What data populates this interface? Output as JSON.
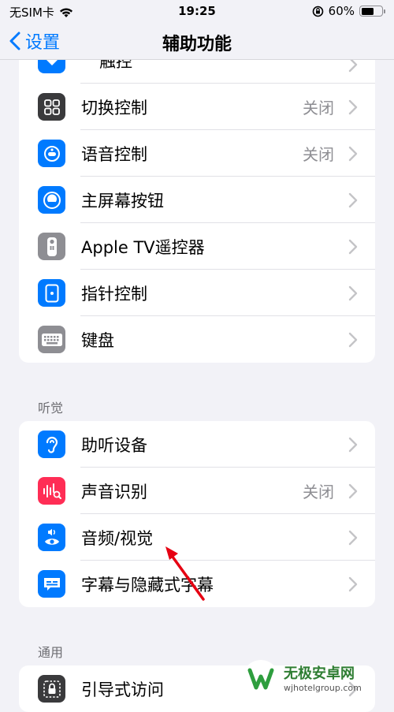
{
  "status_bar": {
    "carrier": "无SIM卡",
    "time": "19:25",
    "battery": "60%",
    "battery_level": 0.6
  },
  "nav": {
    "back_label": "设置",
    "title": "辅助功能"
  },
  "groups": [
    {
      "partial_top_label": "触控",
      "rows": [
        {
          "label": "切换控制",
          "value": "关闭",
          "icon": "switch-control-icon",
          "color": "#3a3a3c"
        },
        {
          "label": "语音控制",
          "value": "关闭",
          "icon": "voice-control-icon",
          "color": "#007aff"
        },
        {
          "label": "主屏幕按钮",
          "value": "",
          "icon": "home-button-icon",
          "color": "#007aff"
        },
        {
          "label": "Apple TV遥控器",
          "value": "",
          "icon": "remote-icon",
          "color": "#8e8e93"
        },
        {
          "label": "指针控制",
          "value": "",
          "icon": "pointer-control-icon",
          "color": "#007aff"
        },
        {
          "label": "键盘",
          "value": "",
          "icon": "keyboard-icon",
          "color": "#8e8e93"
        }
      ]
    },
    {
      "header": "听觉",
      "rows": [
        {
          "label": "助听设备",
          "value": "",
          "icon": "hearing-device-icon",
          "color": "#007aff"
        },
        {
          "label": "声音识别",
          "value": "关闭",
          "icon": "sound-recognition-icon",
          "color": "#ff2d55"
        },
        {
          "label": "音频/视觉",
          "value": "",
          "icon": "audio-visual-icon",
          "color": "#007aff"
        },
        {
          "label": "字幕与隐藏式字幕",
          "value": "",
          "icon": "subtitles-icon",
          "color": "#007aff"
        }
      ]
    },
    {
      "header": "通用",
      "rows": [
        {
          "label": "引导式访问",
          "value": "",
          "icon": "guided-access-icon",
          "color": "#3a3a3c"
        }
      ]
    }
  ],
  "watermark": {
    "title": "无极安卓网",
    "subtitle": "wjhotelgroup.com"
  }
}
